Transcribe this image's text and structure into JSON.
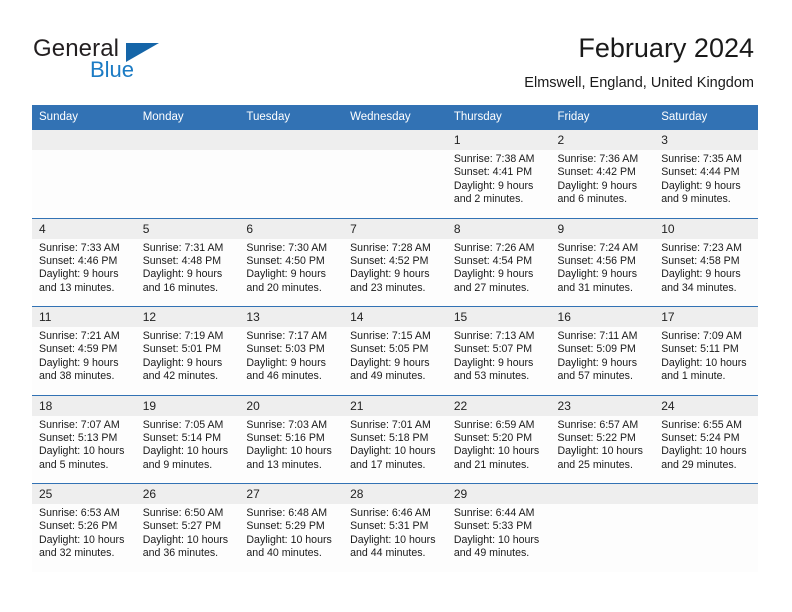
{
  "brand": {
    "name_top": "General",
    "name_bottom": "Blue",
    "accent_color": "#1b7bc4",
    "triangle_color": "#1565a8"
  },
  "header": {
    "title": "February 2024",
    "location": "Elmswell, England, United Kingdom"
  },
  "theme": {
    "header_blue": "#3272b4",
    "daynum_band": "#eeeeee",
    "cell_background": "#fdfdfd",
    "text_color": "#1a1a1a"
  },
  "weekday_headers": [
    "Sunday",
    "Monday",
    "Tuesday",
    "Wednesday",
    "Thursday",
    "Friday",
    "Saturday"
  ],
  "weeks": [
    {
      "days": [
        {
          "number": "",
          "empty": true,
          "sunrise": "",
          "sunset": "",
          "daylight_line1": "",
          "daylight_line2": ""
        },
        {
          "number": "",
          "empty": true,
          "sunrise": "",
          "sunset": "",
          "daylight_line1": "",
          "daylight_line2": ""
        },
        {
          "number": "",
          "empty": true,
          "sunrise": "",
          "sunset": "",
          "daylight_line1": "",
          "daylight_line2": ""
        },
        {
          "number": "",
          "empty": true,
          "sunrise": "",
          "sunset": "",
          "daylight_line1": "",
          "daylight_line2": ""
        },
        {
          "number": "1",
          "empty": false,
          "sunrise": "Sunrise: 7:38 AM",
          "sunset": "Sunset: 4:41 PM",
          "daylight_line1": "Daylight: 9 hours",
          "daylight_line2": "and 2 minutes."
        },
        {
          "number": "2",
          "empty": false,
          "sunrise": "Sunrise: 7:36 AM",
          "sunset": "Sunset: 4:42 PM",
          "daylight_line1": "Daylight: 9 hours",
          "daylight_line2": "and 6 minutes."
        },
        {
          "number": "3",
          "empty": false,
          "sunrise": "Sunrise: 7:35 AM",
          "sunset": "Sunset: 4:44 PM",
          "daylight_line1": "Daylight: 9 hours",
          "daylight_line2": "and 9 minutes."
        }
      ]
    },
    {
      "days": [
        {
          "number": "4",
          "empty": false,
          "sunrise": "Sunrise: 7:33 AM",
          "sunset": "Sunset: 4:46 PM",
          "daylight_line1": "Daylight: 9 hours",
          "daylight_line2": "and 13 minutes."
        },
        {
          "number": "5",
          "empty": false,
          "sunrise": "Sunrise: 7:31 AM",
          "sunset": "Sunset: 4:48 PM",
          "daylight_line1": "Daylight: 9 hours",
          "daylight_line2": "and 16 minutes."
        },
        {
          "number": "6",
          "empty": false,
          "sunrise": "Sunrise: 7:30 AM",
          "sunset": "Sunset: 4:50 PM",
          "daylight_line1": "Daylight: 9 hours",
          "daylight_line2": "and 20 minutes."
        },
        {
          "number": "7",
          "empty": false,
          "sunrise": "Sunrise: 7:28 AM",
          "sunset": "Sunset: 4:52 PM",
          "daylight_line1": "Daylight: 9 hours",
          "daylight_line2": "and 23 minutes."
        },
        {
          "number": "8",
          "empty": false,
          "sunrise": "Sunrise: 7:26 AM",
          "sunset": "Sunset: 4:54 PM",
          "daylight_line1": "Daylight: 9 hours",
          "daylight_line2": "and 27 minutes."
        },
        {
          "number": "9",
          "empty": false,
          "sunrise": "Sunrise: 7:24 AM",
          "sunset": "Sunset: 4:56 PM",
          "daylight_line1": "Daylight: 9 hours",
          "daylight_line2": "and 31 minutes."
        },
        {
          "number": "10",
          "empty": false,
          "sunrise": "Sunrise: 7:23 AM",
          "sunset": "Sunset: 4:58 PM",
          "daylight_line1": "Daylight: 9 hours",
          "daylight_line2": "and 34 minutes."
        }
      ]
    },
    {
      "days": [
        {
          "number": "11",
          "empty": false,
          "sunrise": "Sunrise: 7:21 AM",
          "sunset": "Sunset: 4:59 PM",
          "daylight_line1": "Daylight: 9 hours",
          "daylight_line2": "and 38 minutes."
        },
        {
          "number": "12",
          "empty": false,
          "sunrise": "Sunrise: 7:19 AM",
          "sunset": "Sunset: 5:01 PM",
          "daylight_line1": "Daylight: 9 hours",
          "daylight_line2": "and 42 minutes."
        },
        {
          "number": "13",
          "empty": false,
          "sunrise": "Sunrise: 7:17 AM",
          "sunset": "Sunset: 5:03 PM",
          "daylight_line1": "Daylight: 9 hours",
          "daylight_line2": "and 46 minutes."
        },
        {
          "number": "14",
          "empty": false,
          "sunrise": "Sunrise: 7:15 AM",
          "sunset": "Sunset: 5:05 PM",
          "daylight_line1": "Daylight: 9 hours",
          "daylight_line2": "and 49 minutes."
        },
        {
          "number": "15",
          "empty": false,
          "sunrise": "Sunrise: 7:13 AM",
          "sunset": "Sunset: 5:07 PM",
          "daylight_line1": "Daylight: 9 hours",
          "daylight_line2": "and 53 minutes."
        },
        {
          "number": "16",
          "empty": false,
          "sunrise": "Sunrise: 7:11 AM",
          "sunset": "Sunset: 5:09 PM",
          "daylight_line1": "Daylight: 9 hours",
          "daylight_line2": "and 57 minutes."
        },
        {
          "number": "17",
          "empty": false,
          "sunrise": "Sunrise: 7:09 AM",
          "sunset": "Sunset: 5:11 PM",
          "daylight_line1": "Daylight: 10 hours",
          "daylight_line2": "and 1 minute."
        }
      ]
    },
    {
      "days": [
        {
          "number": "18",
          "empty": false,
          "sunrise": "Sunrise: 7:07 AM",
          "sunset": "Sunset: 5:13 PM",
          "daylight_line1": "Daylight: 10 hours",
          "daylight_line2": "and 5 minutes."
        },
        {
          "number": "19",
          "empty": false,
          "sunrise": "Sunrise: 7:05 AM",
          "sunset": "Sunset: 5:14 PM",
          "daylight_line1": "Daylight: 10 hours",
          "daylight_line2": "and 9 minutes."
        },
        {
          "number": "20",
          "empty": false,
          "sunrise": "Sunrise: 7:03 AM",
          "sunset": "Sunset: 5:16 PM",
          "daylight_line1": "Daylight: 10 hours",
          "daylight_line2": "and 13 minutes."
        },
        {
          "number": "21",
          "empty": false,
          "sunrise": "Sunrise: 7:01 AM",
          "sunset": "Sunset: 5:18 PM",
          "daylight_line1": "Daylight: 10 hours",
          "daylight_line2": "and 17 minutes."
        },
        {
          "number": "22",
          "empty": false,
          "sunrise": "Sunrise: 6:59 AM",
          "sunset": "Sunset: 5:20 PM",
          "daylight_line1": "Daylight: 10 hours",
          "daylight_line2": "and 21 minutes."
        },
        {
          "number": "23",
          "empty": false,
          "sunrise": "Sunrise: 6:57 AM",
          "sunset": "Sunset: 5:22 PM",
          "daylight_line1": "Daylight: 10 hours",
          "daylight_line2": "and 25 minutes."
        },
        {
          "number": "24",
          "empty": false,
          "sunrise": "Sunrise: 6:55 AM",
          "sunset": "Sunset: 5:24 PM",
          "daylight_line1": "Daylight: 10 hours",
          "daylight_line2": "and 29 minutes."
        }
      ]
    },
    {
      "days": [
        {
          "number": "25",
          "empty": false,
          "sunrise": "Sunrise: 6:53 AM",
          "sunset": "Sunset: 5:26 PM",
          "daylight_line1": "Daylight: 10 hours",
          "daylight_line2": "and 32 minutes."
        },
        {
          "number": "26",
          "empty": false,
          "sunrise": "Sunrise: 6:50 AM",
          "sunset": "Sunset: 5:27 PM",
          "daylight_line1": "Daylight: 10 hours",
          "daylight_line2": "and 36 minutes."
        },
        {
          "number": "27",
          "empty": false,
          "sunrise": "Sunrise: 6:48 AM",
          "sunset": "Sunset: 5:29 PM",
          "daylight_line1": "Daylight: 10 hours",
          "daylight_line2": "and 40 minutes."
        },
        {
          "number": "28",
          "empty": false,
          "sunrise": "Sunrise: 6:46 AM",
          "sunset": "Sunset: 5:31 PM",
          "daylight_line1": "Daylight: 10 hours",
          "daylight_line2": "and 44 minutes."
        },
        {
          "number": "29",
          "empty": false,
          "sunrise": "Sunrise: 6:44 AM",
          "sunset": "Sunset: 5:33 PM",
          "daylight_line1": "Daylight: 10 hours",
          "daylight_line2": "and 49 minutes."
        },
        {
          "number": "",
          "empty": true,
          "sunrise": "",
          "sunset": "",
          "daylight_line1": "",
          "daylight_line2": ""
        },
        {
          "number": "",
          "empty": true,
          "sunrise": "",
          "sunset": "",
          "daylight_line1": "",
          "daylight_line2": ""
        }
      ]
    }
  ]
}
